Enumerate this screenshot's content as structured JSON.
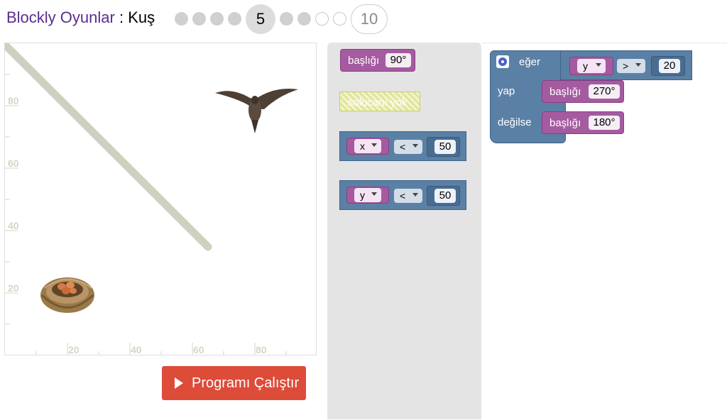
{
  "header": {
    "app_name": "Blockly Oyunlar",
    "separator": " : ",
    "game_name": "Kuş"
  },
  "levels": {
    "current": "5",
    "last": "10",
    "completed_count": 4,
    "todo_count": 4
  },
  "visualization": {
    "x_ticks": [
      "20",
      "40",
      "60",
      "80"
    ],
    "y_ticks": [
      "80",
      "60",
      "40",
      "20"
    ],
    "icons": [
      "bird-icon",
      "nest-icon",
      "wall-line"
    ]
  },
  "run_button": {
    "label": "Programı Çalıştır"
  },
  "toolbox": {
    "heading_block": {
      "label": "başlığı",
      "value": "90°"
    },
    "worm_block": {
      "label": "solucanı yok"
    },
    "compare_x": {
      "var": "x",
      "op": "<",
      "value": "50"
    },
    "compare_y": {
      "var": "y",
      "op": "<",
      "value": "50"
    }
  },
  "workspace": {
    "if_label": "eğer",
    "then_label": "yap",
    "else_label": "değilse",
    "condition": {
      "var": "y",
      "op": ">",
      "value": "20"
    },
    "then_block": {
      "label": "başlığı",
      "value": "270°"
    },
    "else_block": {
      "label": "başlığı",
      "value": "180°"
    }
  },
  "colors": {
    "title": "#5b2d8e",
    "run_button": "#dd4b39",
    "motion_block": "#a55b9f",
    "logic_block": "#5b80a5",
    "wall": "#cfd0bf"
  }
}
